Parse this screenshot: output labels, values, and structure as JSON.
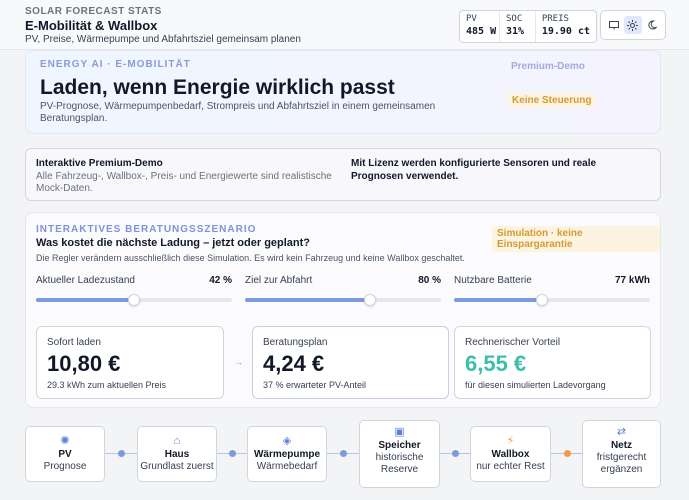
{
  "header": {
    "kicker": "SOLAR FORECAST STATS",
    "title": "E-Mobilität & Wallbox",
    "subtitle": "PV, Preise, Wärmepumpe und Abfahrtsziel gemeinsam planen",
    "stats": [
      {
        "label": "PV",
        "value": "485 W"
      },
      {
        "label": "SOC",
        "value": "31%"
      },
      {
        "label": "PREIS",
        "value": "19.90 ct"
      }
    ],
    "theme_icons": [
      "monitor-icon",
      "sun-icon",
      "moon-icon"
    ]
  },
  "hero": {
    "kicker": "ENERGY AI · E-MOBILITÄT",
    "headline": "Laden, wenn Energie wirklich passt",
    "description": "PV-Prognose, Wärmepumpenbedarf, Strompreis und Abfahrtsziel in einem gemeinsamen Beratungsplan.",
    "badge_demo": "Premium-Demo",
    "badge_no_control": "Keine Steuerung"
  },
  "premium": {
    "title": "Interaktive Premium-Demo",
    "text": "Alle Fahrzeug-, Wallbox-, Preis- und Energiewerte sind realistische Mock-Daten.",
    "right_text": "Mit Lizenz werden konfigurierte Sensoren und reale Prognosen verwendet."
  },
  "scenario": {
    "kicker": "INTERAKTIVES BERATUNGSSZENARIO",
    "question": "Was kostet die nächste Ladung – jetzt oder geplant?",
    "description": "Die Regler verändern ausschließlich diese Simulation. Es wird kein Fahrzeug und keine Wallbox geschaltet.",
    "badge": "Simulation · keine Einspargarantie",
    "sliders": [
      {
        "label": "Aktueller Ladezustand",
        "value": "42 %",
        "fraction": 0.5
      },
      {
        "label": "Ziel zur Abfahrt",
        "value": "80 %",
        "fraction": 0.64
      },
      {
        "label": "Nutzbare Batterie",
        "value": "77 kWh",
        "fraction": 0.45
      }
    ],
    "results": [
      {
        "label": "Sofort laden",
        "value": "10,80 €",
        "sub": "29.3 kWh zum aktuellen Preis"
      },
      {
        "label": "Beratungsplan",
        "value": "4,24 €",
        "sub": "37 % erwarteter PV-Anteil"
      },
      {
        "label": "Rechnerischer Vorteil",
        "value": "6,55 €",
        "sub": "für diesen simulierten Ladevorgang"
      }
    ],
    "arrow": "→"
  },
  "flow": [
    {
      "icon": "sun-icon",
      "glyph": "✺",
      "title": "PV",
      "sub": "Prognose"
    },
    {
      "icon": "house-icon",
      "glyph": "⌂",
      "title": "Haus",
      "sub": "Grundlast zuerst"
    },
    {
      "icon": "diamond-icon",
      "glyph": "◈",
      "title": "Wärmepumpe",
      "sub": "Wärmebedarf"
    },
    {
      "icon": "battery-icon",
      "glyph": "▣",
      "title": "Speicher",
      "sub": "historische Reserve"
    },
    {
      "icon": "lightning-icon",
      "glyph": "⚡",
      "title": "Wallbox",
      "sub": "nur echter Rest"
    },
    {
      "icon": "arrows-icon",
      "glyph": "⇄",
      "title": "Netz",
      "sub": "fristgerecht ergänzen"
    }
  ],
  "colors": {
    "accent": "#7b9be0",
    "positive": "#3bbfa7",
    "warning": "#d59a32",
    "warning_dot": "#ef9b3e"
  }
}
